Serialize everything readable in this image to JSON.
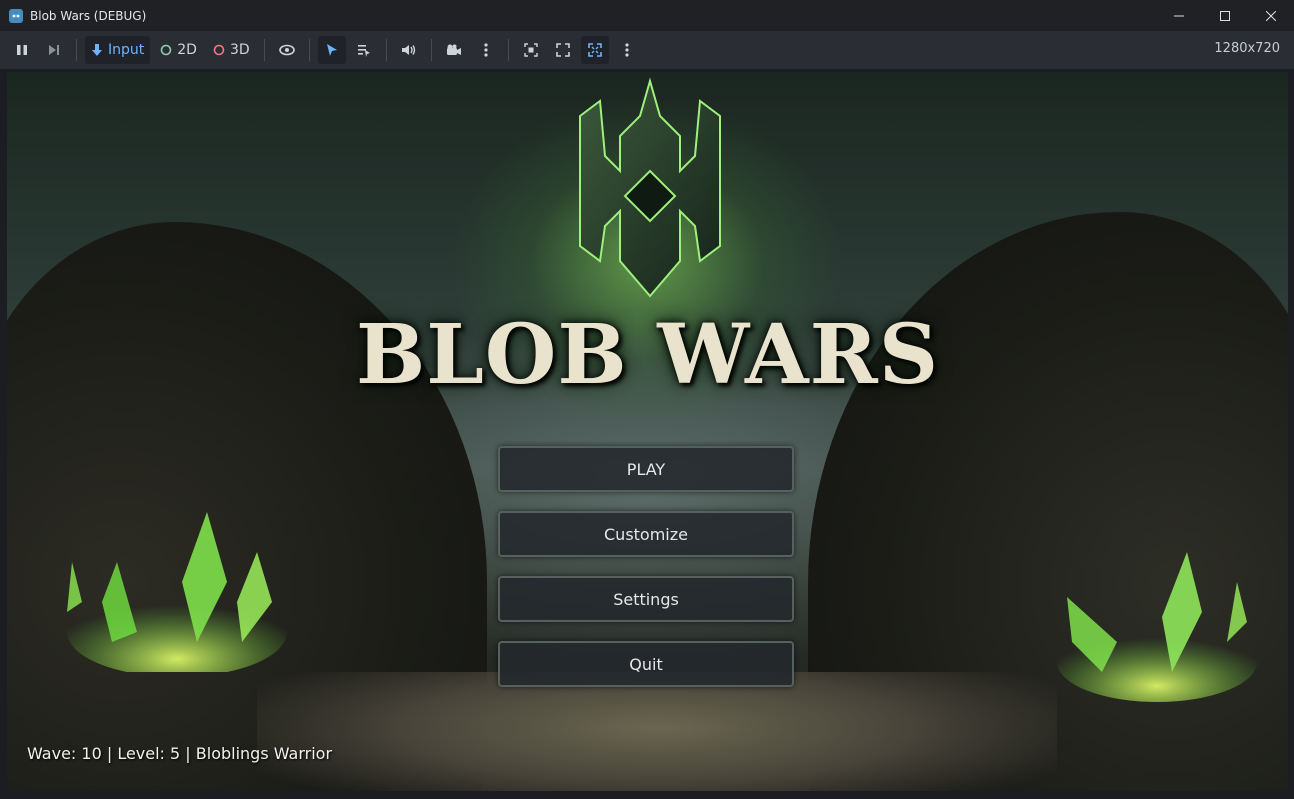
{
  "window": {
    "title": "Blob Wars (DEBUG)",
    "controls": [
      "minimize",
      "maximize",
      "close"
    ]
  },
  "toolbar": {
    "buttons": [
      {
        "name": "pause",
        "icon": "pause-icon"
      },
      {
        "name": "next-frame",
        "icon": "next-frame-icon"
      },
      {
        "name": "input",
        "icon": "input-icon",
        "label": "Input",
        "active": true
      },
      {
        "name": "2d",
        "icon": "2d-icon",
        "label": "2D"
      },
      {
        "name": "3d",
        "icon": "3d-icon",
        "label": "3D"
      },
      {
        "name": "visibility",
        "icon": "eye-icon"
      },
      {
        "name": "select",
        "icon": "cursor-icon",
        "active": true
      },
      {
        "name": "list-select",
        "icon": "list-select-icon"
      },
      {
        "name": "audio",
        "icon": "speaker-icon"
      },
      {
        "name": "camera",
        "icon": "camera-icon"
      },
      {
        "name": "more-1",
        "icon": "more-icon"
      },
      {
        "name": "screenshot",
        "icon": "screenshot-icon"
      },
      {
        "name": "fullscreen",
        "icon": "fullscreen-icon"
      },
      {
        "name": "embed",
        "icon": "embed-icon",
        "active": true
      },
      {
        "name": "more-2",
        "icon": "more-icon"
      }
    ],
    "resolution": "1280x720"
  },
  "game": {
    "title": "BLOB WARS",
    "menu": {
      "play": "PLAY",
      "customize": "Customize",
      "settings": "Settings",
      "quit": "Quit"
    },
    "status": "Wave: 10 | Level: 5 | Bloblings Warrior"
  },
  "colors": {
    "accent": "#478cbf",
    "glow": "#8ee65a",
    "title_text": "#e9e2cc",
    "button_bg": "#23282c",
    "button_border": "#56605c"
  }
}
